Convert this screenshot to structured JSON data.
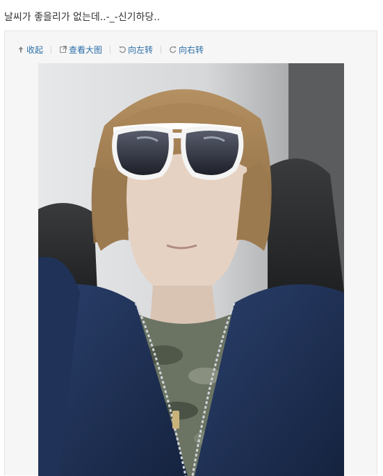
{
  "post": {
    "text": "날씨가 좋을리가 없는데..-_-신기하당.."
  },
  "toolbar": {
    "collapse_label": "收起",
    "view_large_label": "查看大图",
    "rotate_left_label": "向左转",
    "rotate_right_label": "向右转"
  },
  "icons": {
    "collapse": "arrow-up-icon",
    "view_large": "expand-icon",
    "rotate_left": "rotate-left-icon",
    "rotate_right": "rotate-right-icon"
  },
  "colors": {
    "link": "#2b6ea8",
    "panel_bg": "#f6f6f6",
    "panel_border": "#e3e3e3",
    "text": "#333333"
  }
}
